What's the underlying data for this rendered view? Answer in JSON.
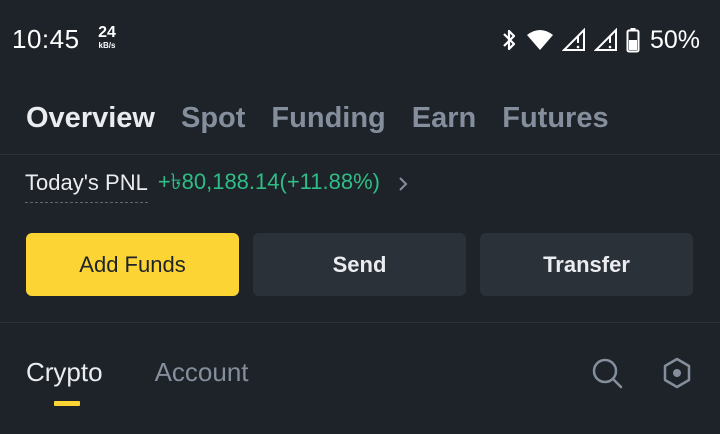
{
  "status_bar": {
    "time": "10:45",
    "net_speed_value": "24",
    "net_speed_unit": "kB/s",
    "battery_percent": "50%",
    "icons": [
      "bluetooth-icon",
      "wifi-icon",
      "signal-icon",
      "signal-icon",
      "battery-icon"
    ]
  },
  "main_tabs": [
    {
      "label": "Overview",
      "active": true
    },
    {
      "label": "Spot",
      "active": false
    },
    {
      "label": "Funding",
      "active": false
    },
    {
      "label": "Earn",
      "active": false
    },
    {
      "label": "Futures",
      "active": false
    }
  ],
  "pnl": {
    "label": "Today's PNL",
    "value": "+৳80,188.14(+11.88%)",
    "icon": "chevron-right-icon"
  },
  "actions": {
    "add_funds": "Add Funds",
    "send": "Send",
    "transfer": "Transfer"
  },
  "sub_tabs": [
    {
      "label": "Crypto",
      "active": true
    },
    {
      "label": "Account",
      "active": false
    }
  ],
  "tools": [
    "search-icon",
    "settings-hexagon-icon"
  ],
  "colors": {
    "background": "#1e2329",
    "accent": "#fcd535",
    "positive": "#2ebd85",
    "secondary_button": "#2b3139",
    "muted_text": "#848e9c"
  }
}
